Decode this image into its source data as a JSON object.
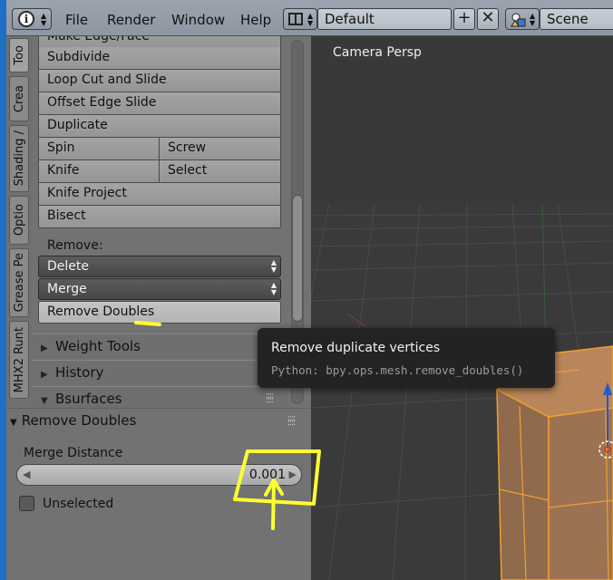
{
  "header": {
    "menus": [
      "File",
      "Render",
      "Window",
      "Help"
    ],
    "screen_layout": "Default",
    "scene": "Scene"
  },
  "tool_tabs": [
    "Too",
    "Crea",
    "Shading /",
    "Optio",
    "Grease Pe",
    "MHX2 Runt"
  ],
  "mesh_tools": {
    "make_edge_face": "Make Edge/Face",
    "subdivide": "Subdivide",
    "loop_cut": "Loop Cut and Slide",
    "offset_edge": "Offset Edge Slide",
    "duplicate": "Duplicate",
    "spin": "Spin",
    "screw": "Screw",
    "knife": "Knife",
    "select": "Select",
    "knife_project": "Knife Project",
    "bisect": "Bisect"
  },
  "remove": {
    "label": "Remove:",
    "delete": "Delete",
    "merge": "Merge",
    "remove_doubles": "Remove Doubles"
  },
  "panels": {
    "weight_tools": "Weight Tools",
    "history": "History",
    "bsurfaces": "Bsurfaces"
  },
  "operator": {
    "title": "Remove Doubles",
    "merge_distance_label": "Merge Distance",
    "merge_distance_value": "0.001",
    "unselected_label": "Unselected",
    "unselected_checked": false
  },
  "viewport": {
    "label": "Camera Persp"
  },
  "tooltip": {
    "title": "Remove duplicate vertices",
    "python": "Python: bpy.ops.mesh.remove_doubles()"
  },
  "colors": {
    "selection_orange": "#f0a030",
    "annotation_yellow": "#ffff33",
    "window_blue": "#1f6fc5"
  }
}
